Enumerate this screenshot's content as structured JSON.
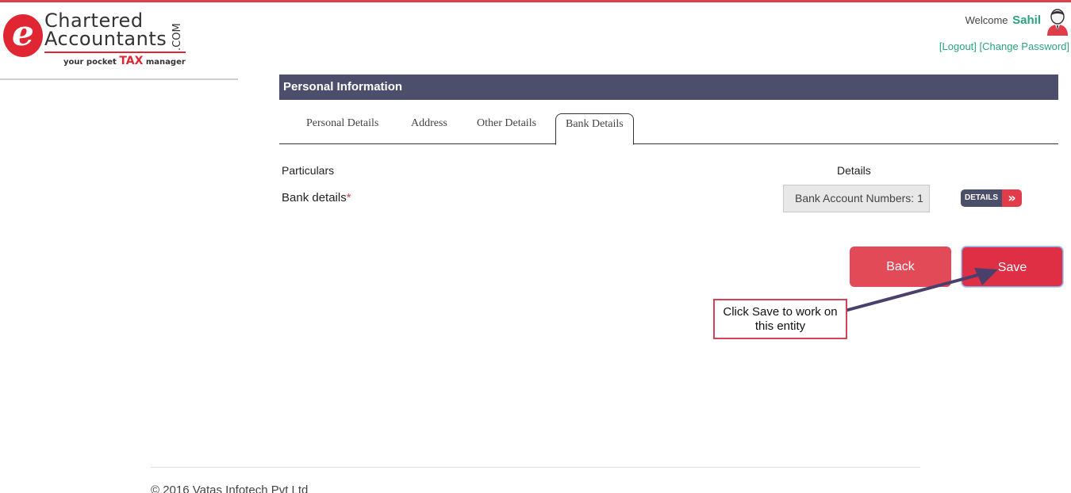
{
  "logo": {
    "e": "e",
    "line1": "Chartered",
    "line2": "Accountants",
    "com": ".COM",
    "tagline_prefix": "your pocket",
    "tagline_tax": "TAX",
    "tagline_suffix": "manager"
  },
  "header": {
    "welcome": "Welcome",
    "user": "Sahil",
    "logout": "[Logout]",
    "change_password": "[Change Password]"
  },
  "panel": {
    "title": "Personal Information",
    "tabs": [
      {
        "label": "Personal Details"
      },
      {
        "label": "Address"
      },
      {
        "label": "Other Details"
      },
      {
        "label": "Bank Details",
        "active": true
      }
    ]
  },
  "table": {
    "col_particulars": "Particulars",
    "col_details": "Details",
    "row": {
      "label": "Bank details",
      "required_mark": "*",
      "value": "Bank Account Numbers: 1",
      "button": "DETAILS",
      "button_arrow": "»"
    }
  },
  "actions": {
    "back": "Back",
    "save": "Save"
  },
  "callout": {
    "line1": "Click Save to work on",
    "line2": "this entity"
  },
  "footer": {
    "copyright": "© 2016 Vatas Infotech Pvt Ltd"
  },
  "colors": {
    "accent_red": "#df2f44",
    "header_navy": "#4b4f6b",
    "link_green": "#2aa37d"
  }
}
